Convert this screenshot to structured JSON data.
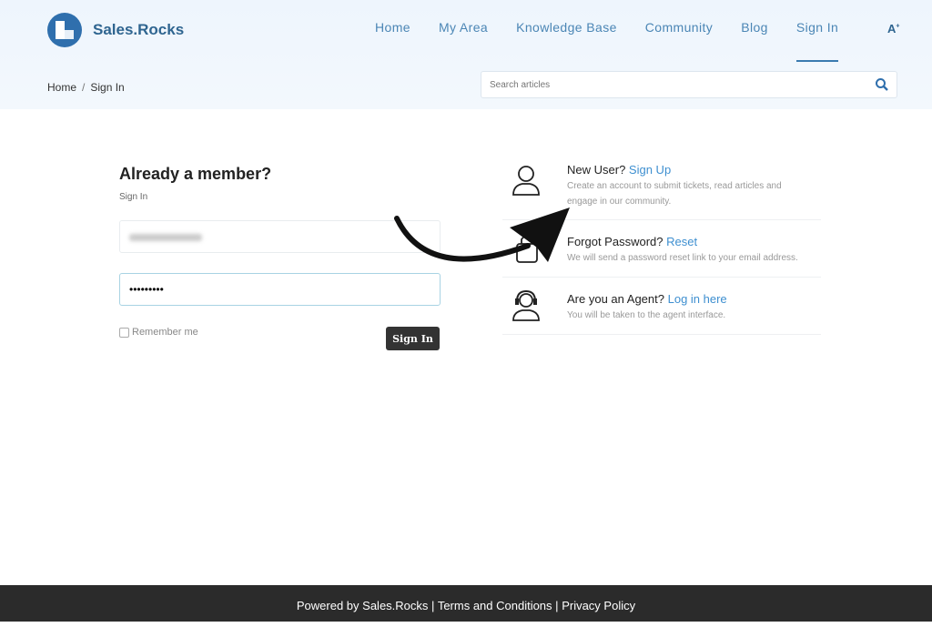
{
  "brand": {
    "name": "Sales.Rocks",
    "color": "#2f6fad"
  },
  "nav": {
    "items": [
      "Home",
      "My Area",
      "Knowledge Base",
      "Community",
      "Blog",
      "Sign In"
    ],
    "active": "Sign In",
    "font_size_icon": "A"
  },
  "breadcrumb": [
    "Home",
    "Sign In"
  ],
  "search": {
    "placeholder": "Search articles",
    "icon": "search-icon"
  },
  "signin": {
    "title": "Already a member?",
    "subtitle": "Sign In",
    "password_value": "•••••••••",
    "remember_label": "Remember me",
    "button_label": "Sign In"
  },
  "options": [
    {
      "question": "New User?",
      "link": "Sign Up",
      "description": "Create an account to submit tickets, read articles and engage in our community.",
      "icon": "user-icon"
    },
    {
      "question": "Forgot Password?",
      "link": "Reset",
      "description": "We will send a password reset link to your email address.",
      "icon": "lock-icon"
    },
    {
      "question": "Are you an Agent?",
      "link": "Log in here",
      "description": "You will be taken to the agent interface.",
      "icon": "headset-icon"
    }
  ],
  "footer": {
    "powered": "Powered by Sales.Rocks",
    "terms": "Terms and Conditions",
    "privacy": "Privacy Policy",
    "separator": "|"
  }
}
